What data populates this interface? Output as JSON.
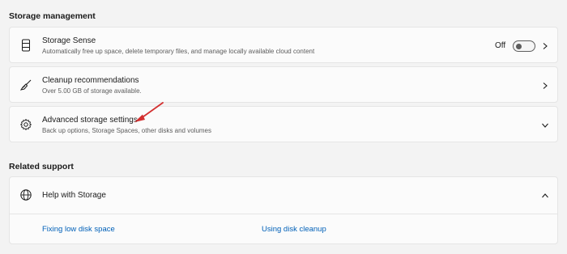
{
  "storage_management": {
    "heading": "Storage management",
    "storage_sense": {
      "title": "Storage Sense",
      "description": "Automatically free up space, delete temporary files, and manage locally available cloud content",
      "toggle_state": "Off",
      "icon": "drive-icon"
    },
    "cleanup": {
      "title": "Cleanup recommendations",
      "description": "Over 5.00 GB of storage available.",
      "icon": "broom-icon"
    },
    "advanced": {
      "title": "Advanced storage settings",
      "description": "Back up options, Storage Spaces, other disks and volumes",
      "icon": "gear-icon"
    }
  },
  "related_support": {
    "heading": "Related support",
    "help": {
      "title": "Help with Storage",
      "icon": "globe-icon",
      "links": [
        "Fixing low disk space",
        "Using disk cleanup"
      ]
    }
  },
  "annotation": {
    "arrow_color": "#d32f2f"
  }
}
